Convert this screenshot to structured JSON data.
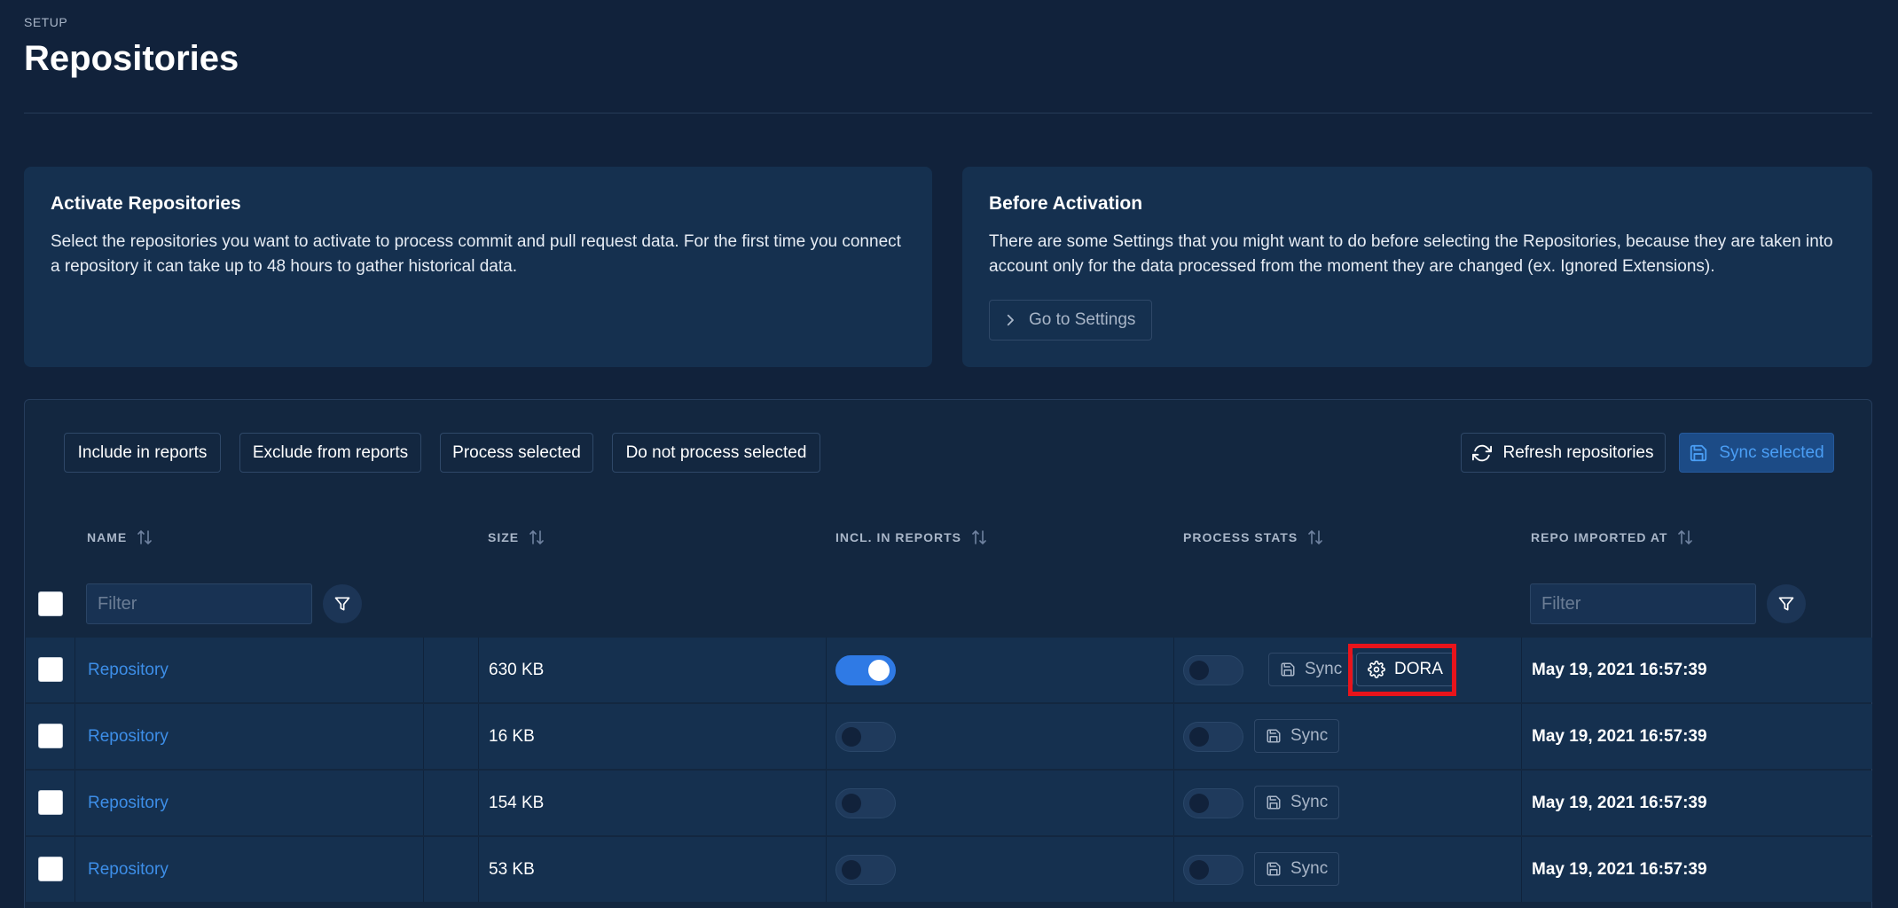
{
  "header": {
    "eyebrow": "SETUP",
    "title": "Repositories"
  },
  "cards": {
    "activate": {
      "title": "Activate Repositories",
      "body": "Select the repositories you want to activate to process commit and pull request data. For the first time you connect a repository it can take up to 48 hours to gather historical data."
    },
    "before": {
      "title": "Before Activation",
      "body": "There are some Settings that you might want to do before selecting the Repositories, because they are taken into account only for the data processed from the moment they are changed (ex. Ignored Extensions).",
      "button_label": "Go to Settings"
    }
  },
  "toolbar": {
    "include": "Include in reports",
    "exclude": "Exclude from reports",
    "process": "Process selected",
    "no_process": "Do not process selected",
    "refresh": "Refresh repositories",
    "sync_selected": "Sync selected"
  },
  "columns": {
    "name": "NAME",
    "size": "SIZE",
    "incl": "INCL. IN REPORTS",
    "process": "PROCESS STATS",
    "imported": "REPO IMPORTED AT"
  },
  "filters": {
    "name_placeholder": "Filter",
    "date_placeholder": "Filter"
  },
  "rows": [
    {
      "name": "Repository",
      "size": "630 KB",
      "included": true,
      "process": false,
      "sync": "Sync",
      "dora": "DORA",
      "imported": "May 19, 2021 16:57:39"
    },
    {
      "name": "Repository",
      "size": "16 KB",
      "included": false,
      "process": false,
      "sync": "Sync",
      "imported": "May 19, 2021 16:57:39"
    },
    {
      "name": "Repository",
      "size": "154 KB",
      "included": false,
      "process": false,
      "sync": "Sync",
      "imported": "May 19, 2021 16:57:39"
    },
    {
      "name": "Repository",
      "size": "53 KB",
      "included": false,
      "process": false,
      "sync": "Sync",
      "imported": "May 19, 2021 16:57:39"
    }
  ],
  "colors": {
    "background": "#11223b",
    "card": "#15304f",
    "link": "#3d8ee8",
    "toggle_on": "#2f7ae5",
    "highlight": "#e8141b"
  }
}
